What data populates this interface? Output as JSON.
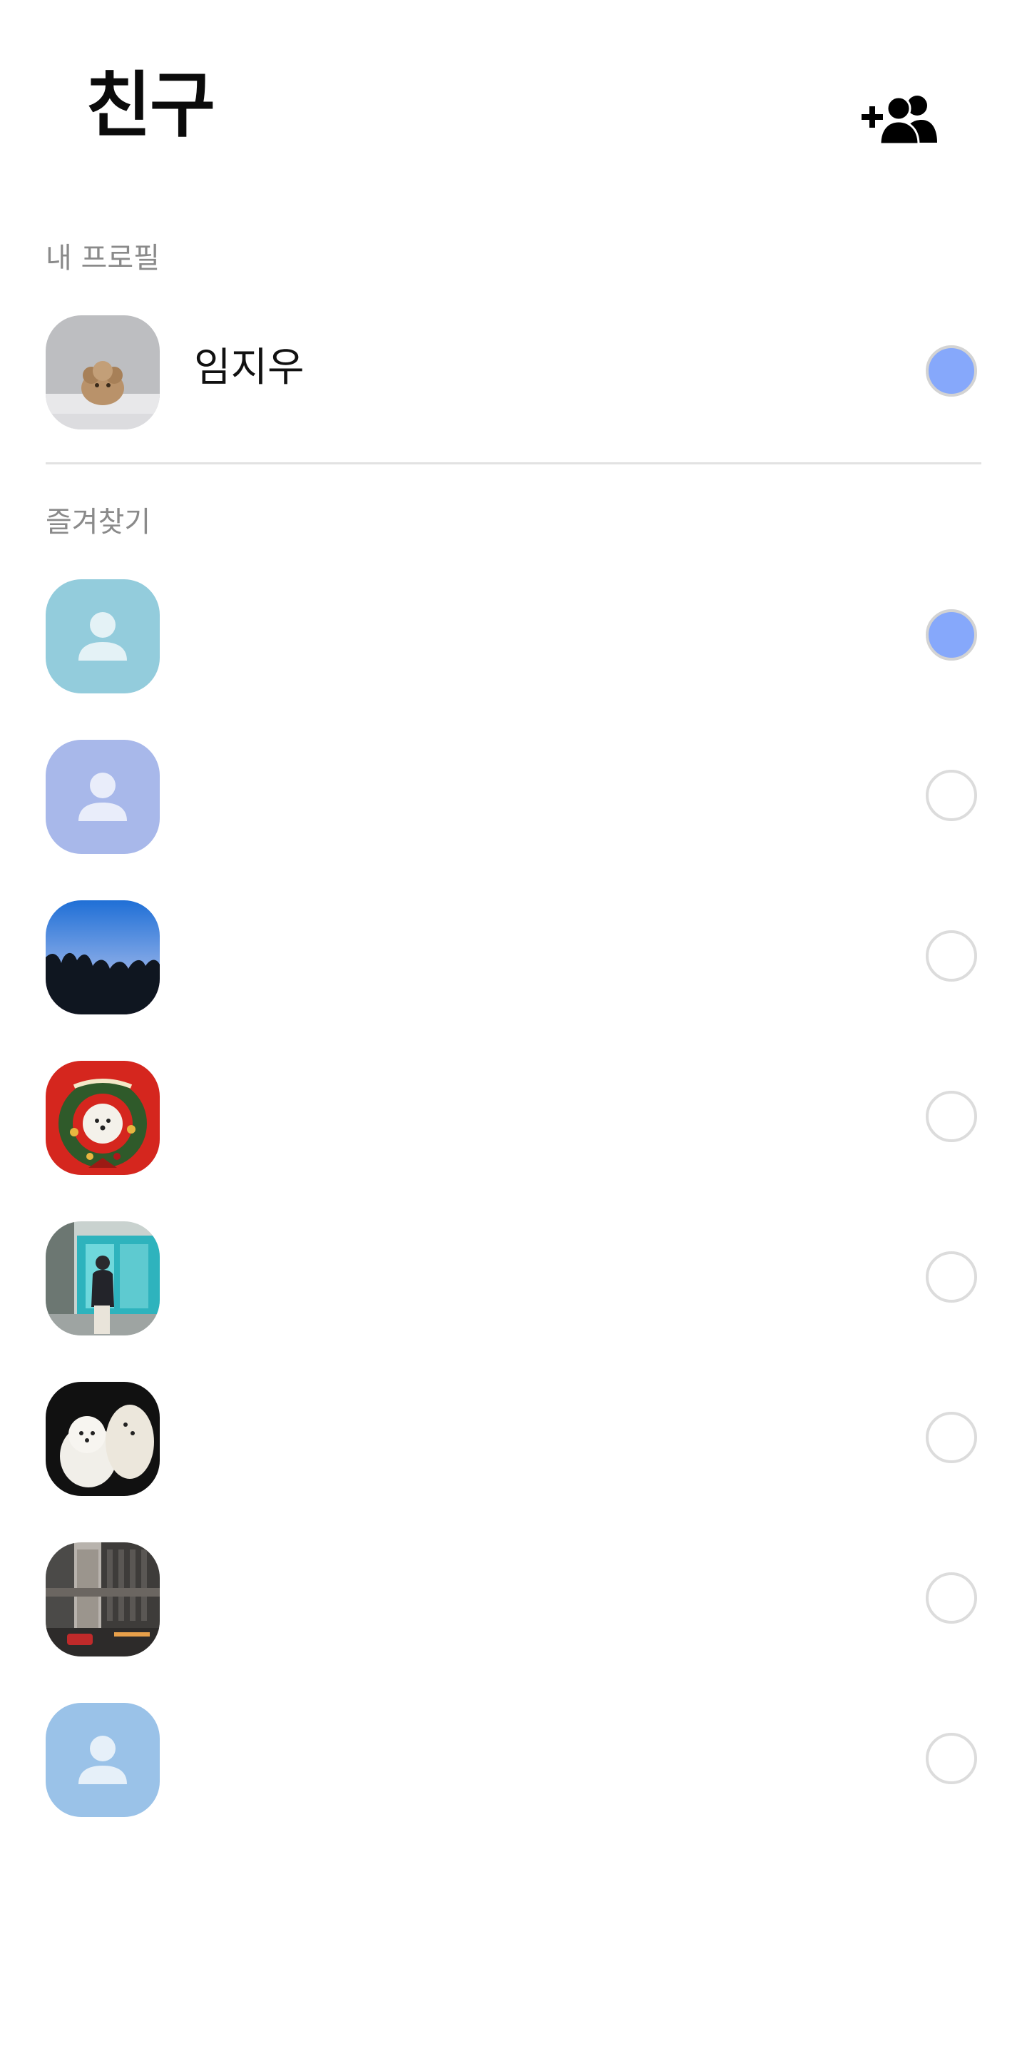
{
  "header": {
    "title": "친구",
    "add_friend_icon": "add-friend-icon"
  },
  "my_profile": {
    "section_label": "내 프로필",
    "name": "임지우",
    "selected": true
  },
  "favorites": {
    "section_label": "즐겨찾기",
    "items": [
      {
        "avatar": "default-person",
        "avatar_color": "#93ccdc",
        "selected": true
      },
      {
        "avatar": "default-person",
        "avatar_color": "#a8b8ea",
        "selected": false
      },
      {
        "avatar": "photo-treeline-sunset",
        "selected": false
      },
      {
        "avatar": "photo-christmas-dog",
        "selected": false
      },
      {
        "avatar": "photo-person-street",
        "selected": false
      },
      {
        "avatar": "photo-two-white-dogs",
        "selected": false
      },
      {
        "avatar": "photo-city-street",
        "selected": false
      },
      {
        "avatar": "default-person",
        "avatar_color": "#9ac2e8",
        "selected": false
      }
    ]
  },
  "colors": {
    "selected_radio": "#86a8fb",
    "radio_border": "#dcdcdc",
    "section_label": "#8a8a8a"
  }
}
